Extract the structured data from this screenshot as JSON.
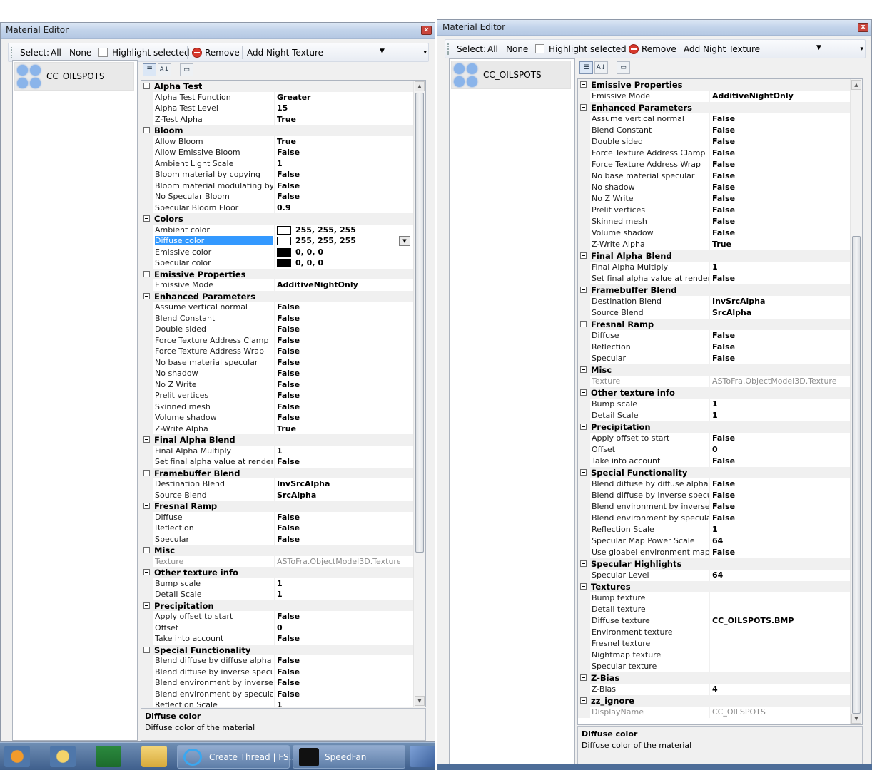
{
  "left": {
    "title": "Material Editor",
    "toolbar": {
      "select": "Select:",
      "all": "All",
      "none": "None",
      "highlight": "Highlight selected",
      "remove": "Remove",
      "add_night": "Add Night Texture"
    },
    "list_item": "CC_OILSPOTS",
    "rows": [
      {
        "t": "cat",
        "n": "Alpha Test"
      },
      {
        "n": "Alpha Test Function",
        "v": "Greater"
      },
      {
        "n": "Alpha Test Level",
        "v": "15"
      },
      {
        "n": "Z-Test Alpha",
        "v": "True"
      },
      {
        "t": "cat",
        "n": "Bloom"
      },
      {
        "n": "Allow Bloom",
        "v": "True"
      },
      {
        "n": "Allow Emissive Bloom",
        "v": "False"
      },
      {
        "n": "Ambient Light Scale",
        "v": "1"
      },
      {
        "n": "Bloom material by copying",
        "v": "False"
      },
      {
        "n": "Bloom material modulating by copyi",
        "v": "False"
      },
      {
        "n": "No Specular Bloom",
        "v": "False"
      },
      {
        "n": "Specular Bloom Floor",
        "v": "0.9"
      },
      {
        "t": "cat",
        "n": "Colors"
      },
      {
        "n": "Ambient color",
        "v": "255, 255, 255",
        "sw": "#ffffff"
      },
      {
        "n": "Diffuse color",
        "v": "255, 255, 255",
        "sw": "#ffffff",
        "sel": true
      },
      {
        "n": "Emissive color",
        "v": "0, 0, 0",
        "sw": "#000000"
      },
      {
        "n": "Specular color",
        "v": "0, 0, 0",
        "sw": "#000000"
      },
      {
        "t": "cat",
        "n": "Emissive Properties"
      },
      {
        "n": "Emissive Mode",
        "v": "AdditiveNightOnly"
      },
      {
        "t": "cat",
        "n": "Enhanced Parameters"
      },
      {
        "n": "Assume vertical normal",
        "v": "False"
      },
      {
        "n": "Blend Constant",
        "v": "False"
      },
      {
        "n": "Double sided",
        "v": "False"
      },
      {
        "n": "Force Texture Address Clamp",
        "v": "False"
      },
      {
        "n": "Force Texture Address Wrap",
        "v": "False"
      },
      {
        "n": "No base material specular",
        "v": "False"
      },
      {
        "n": "No shadow",
        "v": "False"
      },
      {
        "n": "No Z Write",
        "v": "False"
      },
      {
        "n": "Prelit vertices",
        "v": "False"
      },
      {
        "n": "Skinned mesh",
        "v": "False"
      },
      {
        "n": "Volume shadow",
        "v": "False"
      },
      {
        "n": "Z-Write Alpha",
        "v": "True"
      },
      {
        "t": "cat",
        "n": "Final Alpha Blend"
      },
      {
        "n": "Final Alpha Multiply",
        "v": "1"
      },
      {
        "n": "Set final alpha value at render time",
        "v": "False"
      },
      {
        "t": "cat",
        "n": "Framebuffer Blend"
      },
      {
        "n": "Destination Blend",
        "v": "InvSrcAlpha"
      },
      {
        "n": "Source Blend",
        "v": "SrcAlpha"
      },
      {
        "t": "cat",
        "n": "Fresnal Ramp"
      },
      {
        "n": "Diffuse",
        "v": "False"
      },
      {
        "n": "Reflection",
        "v": "False"
      },
      {
        "n": "Specular",
        "v": "False"
      },
      {
        "t": "cat",
        "n": "Misc"
      },
      {
        "n": "Texture",
        "v": "ASToFra.ObjectModel3D.Texture",
        "ro": true
      },
      {
        "t": "cat",
        "n": "Other texture info"
      },
      {
        "n": "Bump scale",
        "v": "1"
      },
      {
        "n": "Detail Scale",
        "v": "1"
      },
      {
        "t": "cat",
        "n": "Precipitation"
      },
      {
        "n": "Apply offset to start",
        "v": "False"
      },
      {
        "n": "Offset",
        "v": "0"
      },
      {
        "n": "Take into account",
        "v": "False"
      },
      {
        "t": "cat",
        "n": "Special Functionality"
      },
      {
        "n": "Blend diffuse by diffuse alpha",
        "v": "False"
      },
      {
        "n": "Blend diffuse by inverse specular al",
        "v": "False"
      },
      {
        "n": "Blend environment by inverse diffus",
        "v": "False"
      },
      {
        "n": "Blend environment by specular alph",
        "v": "False"
      },
      {
        "n": "Reflection Scale",
        "v": "1"
      }
    ],
    "desc_title": "Diffuse color",
    "desc_text": "Diffuse color of the material"
  },
  "right": {
    "title": "Material Editor",
    "toolbar": {
      "select": "Select:",
      "all": "All",
      "none": "None",
      "highlight": "Highlight selected",
      "remove": "Remove",
      "add_night": "Add Night Texture"
    },
    "list_item": "CC_OILSPOTS",
    "rows": [
      {
        "t": "cat",
        "n": "Emissive Properties"
      },
      {
        "n": "Emissive Mode",
        "v": "AdditiveNightOnly"
      },
      {
        "t": "cat",
        "n": "Enhanced Parameters"
      },
      {
        "n": "Assume vertical normal",
        "v": "False"
      },
      {
        "n": "Blend Constant",
        "v": "False"
      },
      {
        "n": "Double sided",
        "v": "False"
      },
      {
        "n": "Force Texture Address Clamp",
        "v": "False"
      },
      {
        "n": "Force Texture Address Wrap",
        "v": "False"
      },
      {
        "n": "No base material specular",
        "v": "False"
      },
      {
        "n": "No shadow",
        "v": "False"
      },
      {
        "n": "No Z Write",
        "v": "False"
      },
      {
        "n": "Prelit vertices",
        "v": "False"
      },
      {
        "n": "Skinned mesh",
        "v": "False"
      },
      {
        "n": "Volume shadow",
        "v": "False"
      },
      {
        "n": "Z-Write Alpha",
        "v": "True"
      },
      {
        "t": "cat",
        "n": "Final Alpha Blend"
      },
      {
        "n": "Final Alpha Multiply",
        "v": "1"
      },
      {
        "n": "Set final alpha value at render time",
        "v": "False"
      },
      {
        "t": "cat",
        "n": "Framebuffer Blend"
      },
      {
        "n": "Destination Blend",
        "v": "InvSrcAlpha"
      },
      {
        "n": "Source Blend",
        "v": "SrcAlpha"
      },
      {
        "t": "cat",
        "n": "Fresnal Ramp"
      },
      {
        "n": "Diffuse",
        "v": "False"
      },
      {
        "n": "Reflection",
        "v": "False"
      },
      {
        "n": "Specular",
        "v": "False"
      },
      {
        "t": "cat",
        "n": "Misc"
      },
      {
        "n": "Texture",
        "v": "ASToFra.ObjectModel3D.Texture",
        "ro": true
      },
      {
        "t": "cat",
        "n": "Other texture info"
      },
      {
        "n": "Bump scale",
        "v": "1"
      },
      {
        "n": "Detail Scale",
        "v": "1"
      },
      {
        "t": "cat",
        "n": "Precipitation"
      },
      {
        "n": "Apply offset to start",
        "v": "False"
      },
      {
        "n": "Offset",
        "v": "0"
      },
      {
        "n": "Take into account",
        "v": "False"
      },
      {
        "t": "cat",
        "n": "Special Functionality"
      },
      {
        "n": "Blend diffuse by diffuse alpha",
        "v": "False"
      },
      {
        "n": "Blend diffuse by inverse specular al",
        "v": "False"
      },
      {
        "n": "Blend environment by inverse diffus",
        "v": "False"
      },
      {
        "n": "Blend environment by specular alph",
        "v": "False"
      },
      {
        "n": "Reflection Scale",
        "v": "1"
      },
      {
        "n": "Specular Map Power Scale",
        "v": "64"
      },
      {
        "n": "Use gloabel environment map as re",
        "v": "False"
      },
      {
        "t": "cat",
        "n": "Specular Highlights"
      },
      {
        "n": "Specular Level",
        "v": "64"
      },
      {
        "t": "cat",
        "n": "Textures"
      },
      {
        "n": "Bump texture",
        "v": ""
      },
      {
        "n": "Detail texture",
        "v": ""
      },
      {
        "n": "Diffuse texture",
        "v": "CC_OILSPOTS.BMP"
      },
      {
        "n": "Environment texture",
        "v": ""
      },
      {
        "n": "Fresnel texture",
        "v": ""
      },
      {
        "n": "Nightmap texture",
        "v": ""
      },
      {
        "n": "Specular texture",
        "v": ""
      },
      {
        "t": "cat",
        "n": "Z-Bias"
      },
      {
        "n": "Z-Bias",
        "v": "4"
      },
      {
        "t": "cat",
        "n": "zz_ignore"
      },
      {
        "n": "DisplayName",
        "v": "CC_OILSPOTS",
        "ro": true
      }
    ],
    "desc_title": "Diffuse color",
    "desc_text": "Diffuse color of the material"
  },
  "taskbar": {
    "tasks": [
      {
        "label": "Create Thread | FS..."
      },
      {
        "label": "SpeedFan"
      }
    ]
  }
}
